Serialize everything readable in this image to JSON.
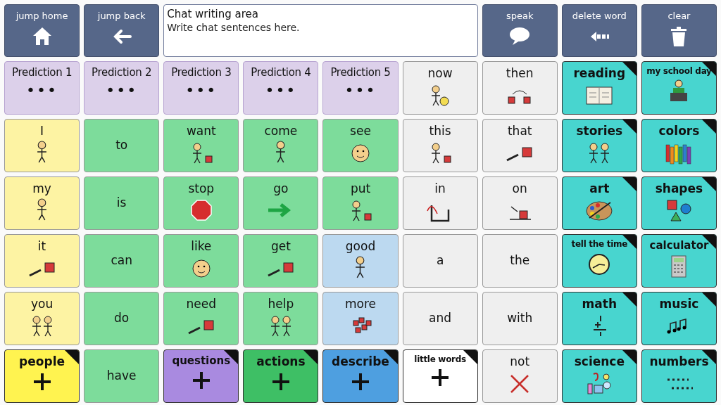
{
  "toolbar": {
    "left_buttons": [
      {
        "label": "jump home",
        "kind": "home"
      },
      {
        "label": "jump back",
        "kind": "back"
      }
    ],
    "chat": {
      "title": "Chat writing area",
      "placeholder": "Write chat sentences here."
    },
    "right_buttons": [
      {
        "label": "speak",
        "kind": "speak"
      },
      {
        "label": "delete word",
        "kind": "delete"
      },
      {
        "label": "clear",
        "kind": "clear"
      }
    ]
  },
  "cells": [
    {
      "label": "Prediction 1",
      "kind": "prediction",
      "dots": "•••",
      "color": "#dcd0ea",
      "folder": false
    },
    {
      "label": "Prediction 2",
      "kind": "prediction",
      "dots": "•••",
      "color": "#dcd0ea",
      "folder": false
    },
    {
      "label": "Prediction 3",
      "kind": "prediction",
      "dots": "•••",
      "color": "#dcd0ea",
      "folder": false
    },
    {
      "label": "Prediction 4",
      "kind": "prediction",
      "dots": "•••",
      "color": "#dcd0ea",
      "folder": false
    },
    {
      "label": "Prediction 5",
      "kind": "prediction",
      "dots": "•••",
      "color": "#dcd0ea",
      "folder": false
    },
    {
      "label": "now",
      "kind": "symbol",
      "color": "#efefef",
      "folder": false
    },
    {
      "label": "then",
      "kind": "symbol",
      "color": "#efefef",
      "folder": false
    },
    {
      "label": "reading",
      "kind": "symbol",
      "color": "#48d5cf",
      "folder": true
    },
    {
      "label": "my school day",
      "kind": "symbol",
      "color": "#48d5cf",
      "folder": true
    },
    {
      "label": "I",
      "kind": "symbol",
      "color": "#fdf3a3",
      "folder": false
    },
    {
      "label": "to",
      "kind": "text",
      "color": "#7ddc9b",
      "folder": false
    },
    {
      "label": "want",
      "kind": "symbol",
      "color": "#7ddc9b",
      "folder": false
    },
    {
      "label": "come",
      "kind": "symbol",
      "color": "#7ddc9b",
      "folder": false
    },
    {
      "label": "see",
      "kind": "symbol",
      "color": "#7ddc9b",
      "folder": false
    },
    {
      "label": "this",
      "kind": "symbol",
      "color": "#efefef",
      "folder": false
    },
    {
      "label": "that",
      "kind": "symbol",
      "color": "#efefef",
      "folder": false
    },
    {
      "label": "stories",
      "kind": "symbol",
      "color": "#48d5cf",
      "folder": true
    },
    {
      "label": "colors",
      "kind": "symbol",
      "color": "#48d5cf",
      "folder": true
    },
    {
      "label": "my",
      "kind": "symbol",
      "color": "#fdf3a3",
      "folder": false
    },
    {
      "label": "is",
      "kind": "text",
      "color": "#7ddc9b",
      "folder": false
    },
    {
      "label": "stop",
      "kind": "symbol",
      "color": "#7ddc9b",
      "folder": false
    },
    {
      "label": "go",
      "kind": "symbol",
      "color": "#7ddc9b",
      "folder": false
    },
    {
      "label": "put",
      "kind": "symbol",
      "color": "#7ddc9b",
      "folder": false
    },
    {
      "label": "in",
      "kind": "symbol",
      "color": "#efefef",
      "folder": false
    },
    {
      "label": "on",
      "kind": "symbol",
      "color": "#efefef",
      "folder": false
    },
    {
      "label": "art",
      "kind": "symbol",
      "color": "#48d5cf",
      "folder": true
    },
    {
      "label": "shapes",
      "kind": "symbol",
      "color": "#48d5cf",
      "folder": true
    },
    {
      "label": "it",
      "kind": "symbol",
      "color": "#fdf3a3",
      "folder": false
    },
    {
      "label": "can",
      "kind": "text",
      "color": "#7ddc9b",
      "folder": false
    },
    {
      "label": "like",
      "kind": "symbol",
      "color": "#7ddc9b",
      "folder": false
    },
    {
      "label": "get",
      "kind": "symbol",
      "color": "#7ddc9b",
      "folder": false
    },
    {
      "label": "good",
      "kind": "symbol",
      "color": "#bcd9f0",
      "folder": false
    },
    {
      "label": "a",
      "kind": "text",
      "color": "#efefef",
      "folder": false
    },
    {
      "label": "the",
      "kind": "text",
      "color": "#efefef",
      "folder": false
    },
    {
      "label": "tell the time",
      "kind": "symbol",
      "color": "#48d5cf",
      "folder": true
    },
    {
      "label": "calculator",
      "kind": "symbol",
      "color": "#48d5cf",
      "folder": true
    },
    {
      "label": "you",
      "kind": "symbol",
      "color": "#fdf3a3",
      "folder": false
    },
    {
      "label": "do",
      "kind": "text",
      "color": "#7ddc9b",
      "folder": false
    },
    {
      "label": "need",
      "kind": "symbol",
      "color": "#7ddc9b",
      "folder": false
    },
    {
      "label": "help",
      "kind": "symbol",
      "color": "#7ddc9b",
      "folder": false
    },
    {
      "label": "more",
      "kind": "symbol",
      "color": "#bcd9f0",
      "folder": false
    },
    {
      "label": "and",
      "kind": "text",
      "color": "#efefef",
      "folder": false
    },
    {
      "label": "with",
      "kind": "text",
      "color": "#efefef",
      "folder": false
    },
    {
      "label": "math",
      "kind": "symbol",
      "color": "#48d5cf",
      "folder": true
    },
    {
      "label": "music",
      "kind": "symbol",
      "color": "#48d5cf",
      "folder": true
    },
    {
      "label": "people",
      "kind": "category",
      "color": "#fff350",
      "folder": true
    },
    {
      "label": "have",
      "kind": "text",
      "color": "#7ddc9b",
      "folder": false
    },
    {
      "label": "questions",
      "kind": "category",
      "color": "#a98ae0",
      "folder": true
    },
    {
      "label": "actions",
      "kind": "category",
      "color": "#3ebf65",
      "folder": true
    },
    {
      "label": "describe",
      "kind": "category",
      "color": "#4e9fe0",
      "folder": true
    },
    {
      "label": "little words",
      "kind": "category",
      "color": "#ffffff",
      "folder": true
    },
    {
      "label": "not",
      "kind": "symbol",
      "color": "#efefef",
      "folder": false
    },
    {
      "label": "science",
      "kind": "symbol",
      "color": "#48d5cf",
      "folder": true
    },
    {
      "label": "numbers",
      "kind": "symbol",
      "color": "#48d5cf",
      "folder": true
    }
  ]
}
